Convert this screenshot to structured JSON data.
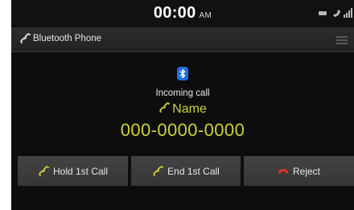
{
  "status_bar": {
    "time": "00:00",
    "ampm": "AM",
    "icons": [
      "battery-icon",
      "phone-connected-icon",
      "signal-strength-icon"
    ]
  },
  "title_bar": {
    "icon": "bluetooth-phone-icon",
    "title": "Bluetooth Phone",
    "menu_icon": "menu-icon"
  },
  "call": {
    "connection_icon": "bluetooth-icon",
    "status": "Incoming call",
    "caller_name": "Name",
    "caller_number": "000-0000-0000"
  },
  "actions": [
    {
      "label": "Hold 1st Call",
      "icon": "handset-hold-icon"
    },
    {
      "label": "End 1st Call",
      "icon": "handset-end-icon"
    },
    {
      "label": "Reject",
      "icon": "handset-reject-icon"
    }
  ],
  "colors": {
    "accent": "#cdd23a",
    "bluetooth": "#1f6fe0",
    "reject": "#d8342c",
    "background": "#0d0d0d"
  }
}
